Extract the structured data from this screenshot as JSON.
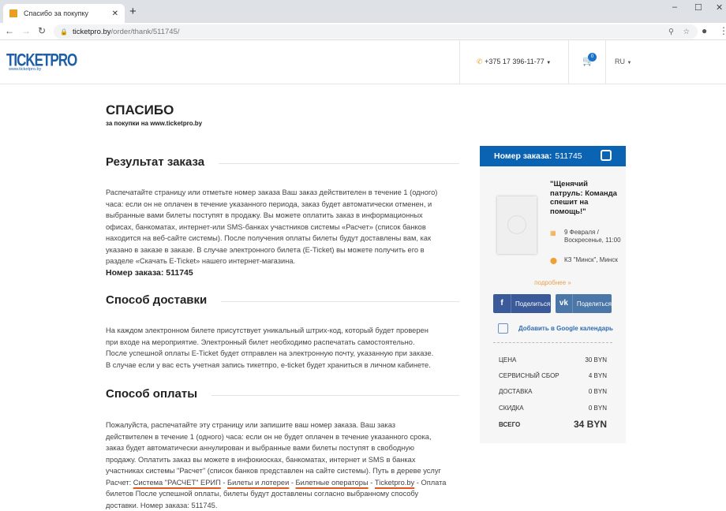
{
  "browser": {
    "tab_title": "Спасибо за покупку",
    "url_host": "ticketpro.by",
    "url_path": "/order/thank/511745/"
  },
  "header": {
    "logo": "TICKETPRO",
    "logo_sub": "www.ticketpro.by",
    "phone": "+375 17 396-11-77",
    "cart_count": "0",
    "lang": "RU"
  },
  "main": {
    "title": "СПАСИБО",
    "subtitle": "за покупки на www.ticketpro.by",
    "result_heading": "Результат заказа",
    "result_lines": [
      "Распечатайте страницу или отметьте номер заказа Ваш заказ действителен в течение 1 (одного)",
      "часа: если он не оплачен в течение указанного периода, заказ будет автоматически отменен, и",
      "выбранные вами билеты поступят в продажу. Вы можете оплатить заказ в информационных",
      "офисах, банкоматах, интернет-или SMS-банках участников системы «Расчет» (список банков",
      "находится на веб-сайте системы). После получения оплаты билеты будут доставлены вам, как",
      "указано в заказе в заказе. В случае электронного билета (E-Ticket) вы можете получить его в",
      "разделе «Скачать E-Ticket» нашего интернет-магазина."
    ],
    "order_number_label": "Номер заказа: 511745",
    "delivery_heading": "Способ доставки",
    "delivery_lines": [
      "На каждом электронном билете присутствует уникальный штрих-код, который будет проверен",
      "при входе на мероприятие. Электронный билет необходимо распечатать самостоятельно.",
      "После успешной оплаты E-Ticket будет отправлен на электронную почту, указанную при заказе.",
      "В случае если у вас есть учетная запись тикетпро, e-ticket будет храниться в личном кабинете."
    ],
    "payment_heading": "Способ оплаты",
    "payment_lines": [
      "Пожалуйста, распечатайте эту страницу или запишите ваш номер заказа. Ваш заказ",
      "действителен в течение 1 (одного) часа: если он не будет оплачен в течение указанного срока,",
      "заказ будет автоматически аннулирован и выбранные вами билеты поступят в свободную",
      "продажу. Оплатить заказ вы можете в инфокиосках, банкоматах, интернет и SMS в банках",
      "участниках системы \"Расчет\" (список банков представлен на сайте системы). Путь в дереве услуг"
    ],
    "payment_path": {
      "prefix": "Расчет: ",
      "steps": [
        "Система \"РАСЧЕТ\" ЕРИП",
        "Билеты и лотереи",
        "Билетные операторы",
        "Ticketpro.by"
      ],
      "sep": " - ",
      "suffix": " - Оплата"
    },
    "payment_tail": [
      "билетов После успешной оплаты, билеты будут доставлены согласно выбранному способу",
      "доставки. Номер заказа: 511745."
    ]
  },
  "sidebar": {
    "order_label": "Номер заказа:",
    "order_number": "511745",
    "event_title": "\"Щенячий патруль: Команда спешит на помощь!\"",
    "date": "9 Февраля / Воскресенье, 11:00",
    "venue": "КЗ \"Минск\", Минск",
    "more": "подробнее »",
    "share_fb": "Поделиться",
    "share_vk": "Поделиться",
    "gcal": "Добавить в Google календарь",
    "rows": [
      {
        "label": "ЦЕНА",
        "value": "30 BYN"
      },
      {
        "label": "СЕРВИСНЫЙ СБОР",
        "value": "4 BYN"
      },
      {
        "label": "ДОСТАВКА",
        "value": "0 BYN"
      },
      {
        "label": "СКИДКА",
        "value": "0 BYN"
      },
      {
        "label": "ВСЕГО",
        "value": "34 BYN"
      }
    ]
  },
  "colors": {
    "accent": "#0b63b4",
    "orange": "#e05a1e"
  }
}
